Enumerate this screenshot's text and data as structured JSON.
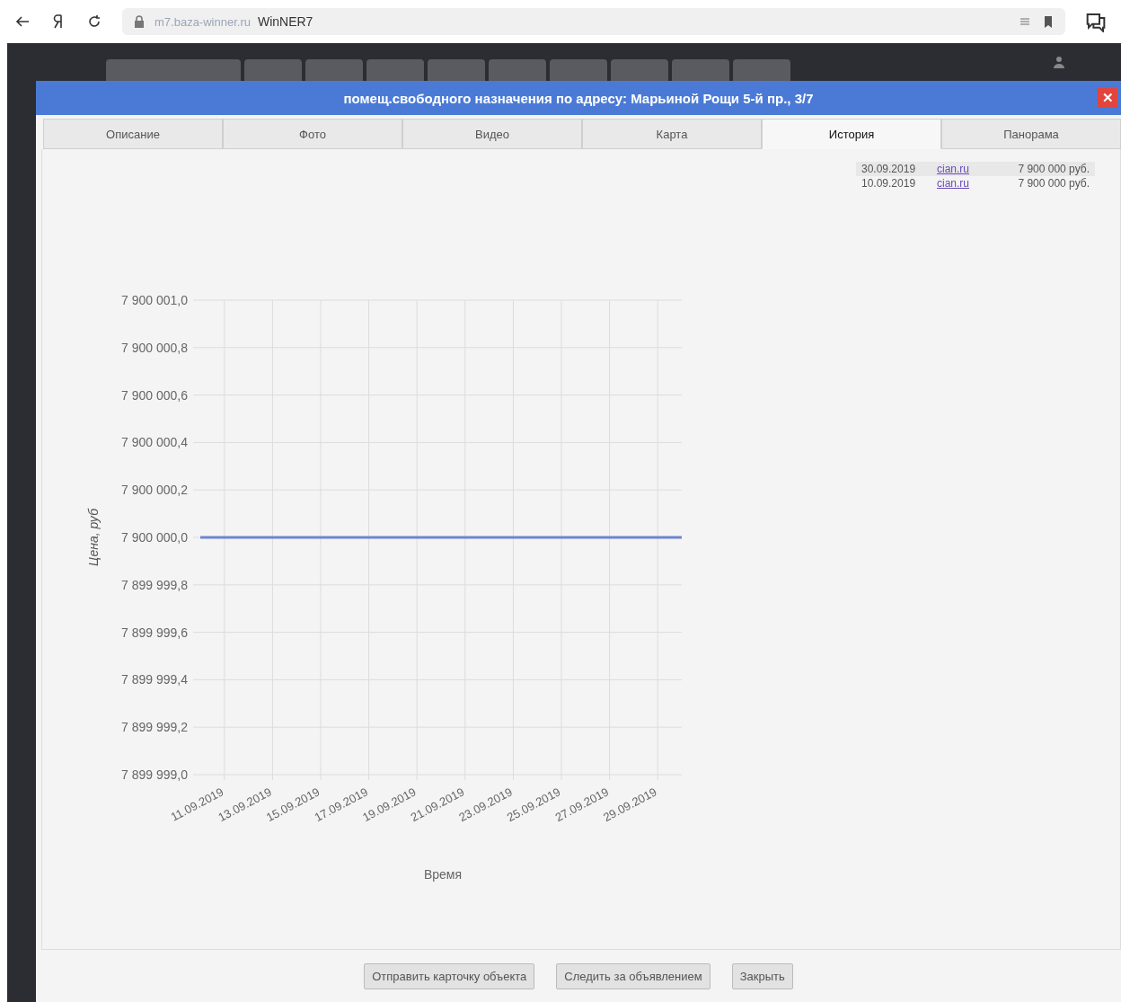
{
  "browser": {
    "url": "m7.baza-winner.ru",
    "title": "WinNER7"
  },
  "modal": {
    "title": "помещ.свободного назначения по адресу: Марьиной Рощи 5-й пр., 3/7",
    "close": "✕",
    "tabs": [
      {
        "label": "Описание",
        "selected": false
      },
      {
        "label": "Фото",
        "selected": false
      },
      {
        "label": "Видео",
        "selected": false
      },
      {
        "label": "Карта",
        "selected": false
      },
      {
        "label": "История",
        "selected": true
      },
      {
        "label": "Панорама",
        "selected": false
      }
    ],
    "history": [
      {
        "date": "30.09.2019",
        "source": "cian.ru",
        "price": "7 900 000 руб."
      },
      {
        "date": "10.09.2019",
        "source": "cian.ru",
        "price": "7 900 000 руб."
      }
    ],
    "chart_data": {
      "type": "line",
      "xlabel": "Время",
      "ylabel": "Цена, руб",
      "categories": [
        null,
        "11.09.2019",
        null,
        "13.09.2019",
        null,
        "15.09.2019",
        null,
        "17.09.2019",
        null,
        "19.09.2019",
        null,
        "21.09.2019",
        null,
        "23.09.2019",
        null,
        "25.09.2019",
        null,
        "27.09.2019",
        null,
        "29.09.2019",
        null
      ],
      "series": [
        {
          "color": "#6f85cf",
          "values": [
            7900000,
            7900000,
            7900000,
            7900000,
            7900000,
            7900000,
            7900000,
            7900000,
            7900000,
            7900000,
            7900000,
            7900000,
            7900000,
            7900000,
            7900000,
            7900000,
            7900000,
            7900000,
            7900000,
            7900000,
            7900000
          ]
        }
      ],
      "ylim": [
        7899999,
        7900001
      ],
      "grid": true,
      "yticks": [
        {
          "value": 7900001,
          "label": "7 900 001,0"
        },
        {
          "value": 7900000.8,
          "label": "7 900 000,8"
        },
        {
          "value": 7900000.6,
          "label": "7 900 000,6"
        },
        {
          "value": 7900000.4,
          "label": "7 900 000,4"
        },
        {
          "value": 7900000.2,
          "label": "7 900 000,2"
        },
        {
          "value": 7900000,
          "label": "7 900 000,0"
        },
        {
          "value": 7899999.8,
          "label": "7 899 999,8"
        },
        {
          "value": 7899999.6,
          "label": "7 899 999,6"
        },
        {
          "value": 7899999.4,
          "label": "7 899 999,4"
        },
        {
          "value": 7899999.2,
          "label": "7 899 999,2"
        },
        {
          "value": 7899999,
          "label": "7 899 999,0"
        }
      ]
    },
    "buttons": [
      "Отправить карточку объекта",
      "Следить за объявлением",
      "Закрыть"
    ]
  }
}
